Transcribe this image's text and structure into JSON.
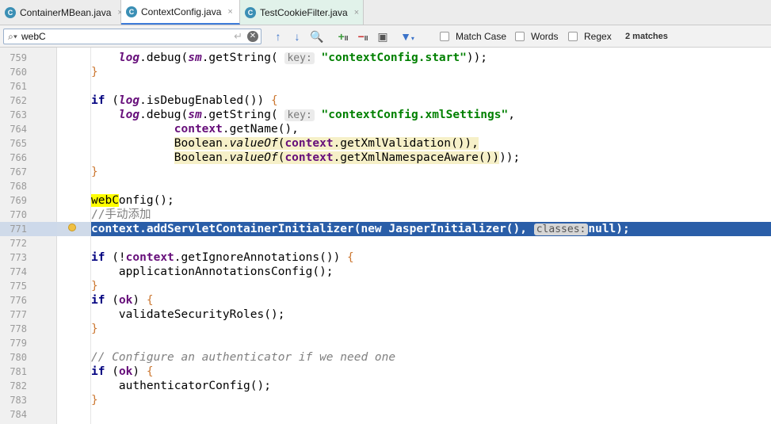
{
  "tabs": [
    {
      "icon": "C",
      "label": "ContainerMBean.java",
      "close": "×"
    },
    {
      "icon": "C",
      "label": "ContextConfig.java",
      "close": "×"
    },
    {
      "icon": "C",
      "label": "TestCookieFilter.java",
      "close": "×"
    }
  ],
  "search": {
    "query": "webC",
    "options": {
      "match_case": "Match Case",
      "words": "Words",
      "regex": "Regex"
    },
    "matches": "2 matches"
  },
  "editor": {
    "lines": {
      "l759": "759",
      "l760": "760",
      "l761": "761",
      "l762": "762",
      "l763": "763",
      "l764": "764",
      "l765": "765",
      "l766": "766",
      "l767": "767",
      "l768": "768",
      "l769": "769",
      "l770": "770",
      "l771": "771",
      "l772": "772",
      "l773": "773",
      "l774": "774",
      "l775": "775",
      "l776": "776",
      "l777": "777",
      "l778": "778",
      "l779": "779",
      "l780": "780",
      "l781": "781",
      "l782": "782",
      "l783": "783",
      "l784": "784"
    },
    "tokens": {
      "log": "log",
      "sm": "sm",
      "context": "context",
      "hint_key": "key:",
      "hint_classes": "classes:",
      "str_start": "\"contextConfig.start\"",
      "str_xml": "\"contextConfig.xmlSettings\"",
      "kw_if": "if",
      "kw_new": "new",
      "kw_null": "null",
      "ok": "ok",
      "boolean": "Boolean",
      "value_of": "valueOf",
      "web_match": "webC",
      "web_rest": "onfig",
      "comment_cn": "//手动添加",
      "comment_auth": "// Configure an authenticator if we need one"
    }
  },
  "colors": {
    "selection": "#2a5ea8",
    "search_match": "#ffff00",
    "keyword": "#000080",
    "string": "#008000",
    "field": "#660e7a"
  }
}
